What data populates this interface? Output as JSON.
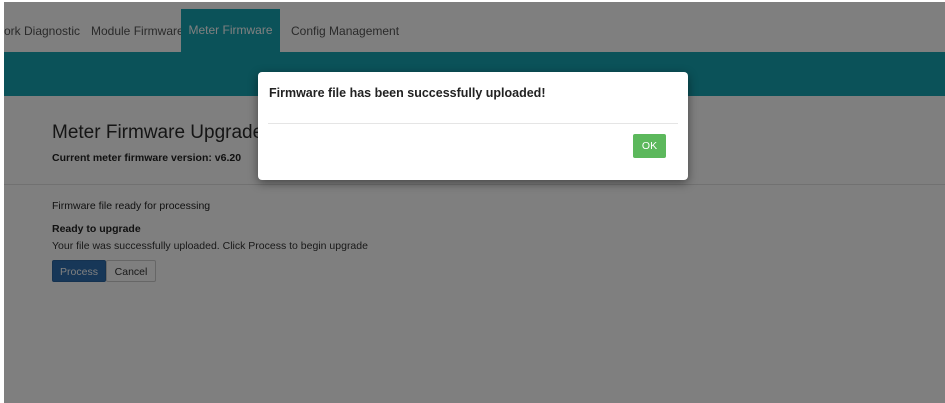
{
  "tabs": [
    {
      "label": "ork Diagnostic",
      "active": false
    },
    {
      "label": "Module Firmware",
      "active": false
    },
    {
      "label": "Meter Firmware",
      "active": true
    },
    {
      "label": "Config Management",
      "active": false
    }
  ],
  "page": {
    "title": "Meter Firmware Upgrade",
    "current_version": "Current meter firmware version: v6.20",
    "status_title": "Firmware file ready for processing",
    "ready_title": "Ready to upgrade",
    "ready_text": "Your file was successfully uploaded. Click Process to begin upgrade",
    "process_label": "Process",
    "cancel_label": "Cancel"
  },
  "modal": {
    "message": "Firmware file has been successfully uploaded!",
    "ok_label": "OK"
  },
  "colors": {
    "accent_teal": "#17a5b2",
    "primary_blue": "#2f6fb0",
    "success_green": "#5cb85c"
  }
}
